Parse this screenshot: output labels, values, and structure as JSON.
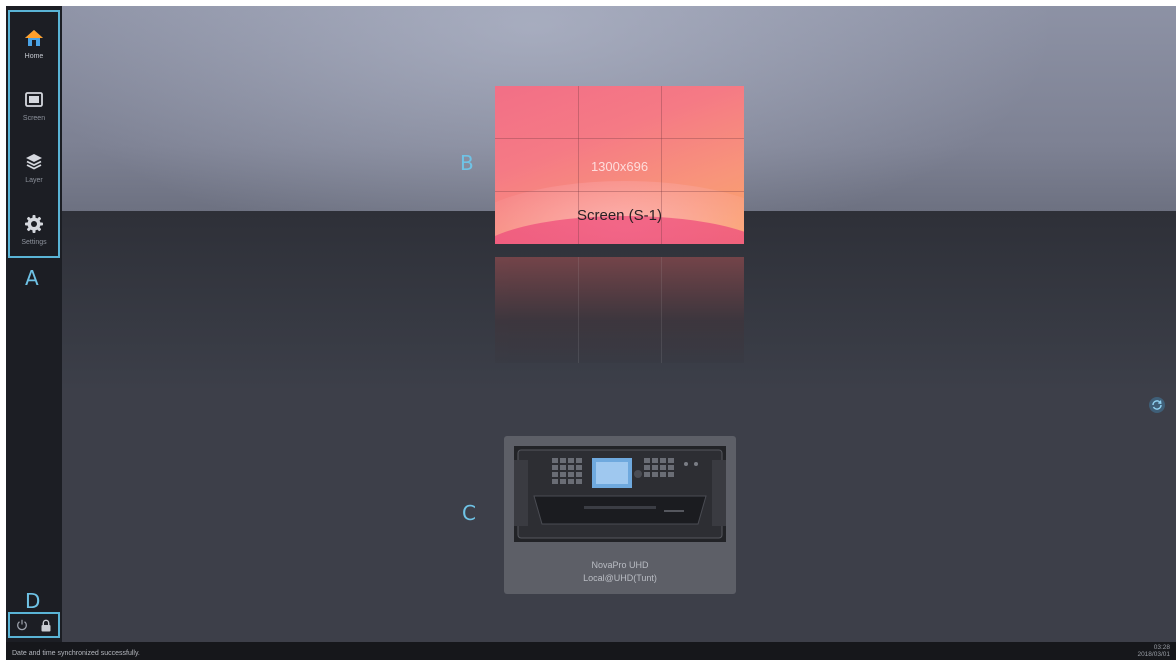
{
  "sidebar": {
    "items": [
      {
        "label": "Home",
        "icon": "home-icon",
        "active": true
      },
      {
        "label": "Screen",
        "icon": "screen-icon",
        "active": false
      },
      {
        "label": "Layer",
        "icon": "layers-icon",
        "active": false
      },
      {
        "label": "Settings",
        "icon": "gear-icon",
        "active": false
      }
    ],
    "bottom": [
      {
        "icon": "power-icon"
      },
      {
        "icon": "lock-icon"
      }
    ]
  },
  "callouts": {
    "a": "A",
    "b": "B",
    "c": "C",
    "d": "D"
  },
  "screen": {
    "resolution": "1300x696",
    "name": "Screen (S-1)"
  },
  "device": {
    "model": "NovaPro UHD",
    "connection": "Local@UHD(Tunt)",
    "image_icon": "device-chassis-image"
  },
  "refresh": {
    "icon": "refresh-icon"
  },
  "status": {
    "message": "Date and time synchronized successfully.",
    "time": "03:28",
    "date": "2018/03/01"
  },
  "colors": {
    "accent": "#5ab4d6",
    "callout": "#6fc3e6",
    "sidebar_bg": "#1c1e24",
    "home_active": "#4aa3e6"
  }
}
